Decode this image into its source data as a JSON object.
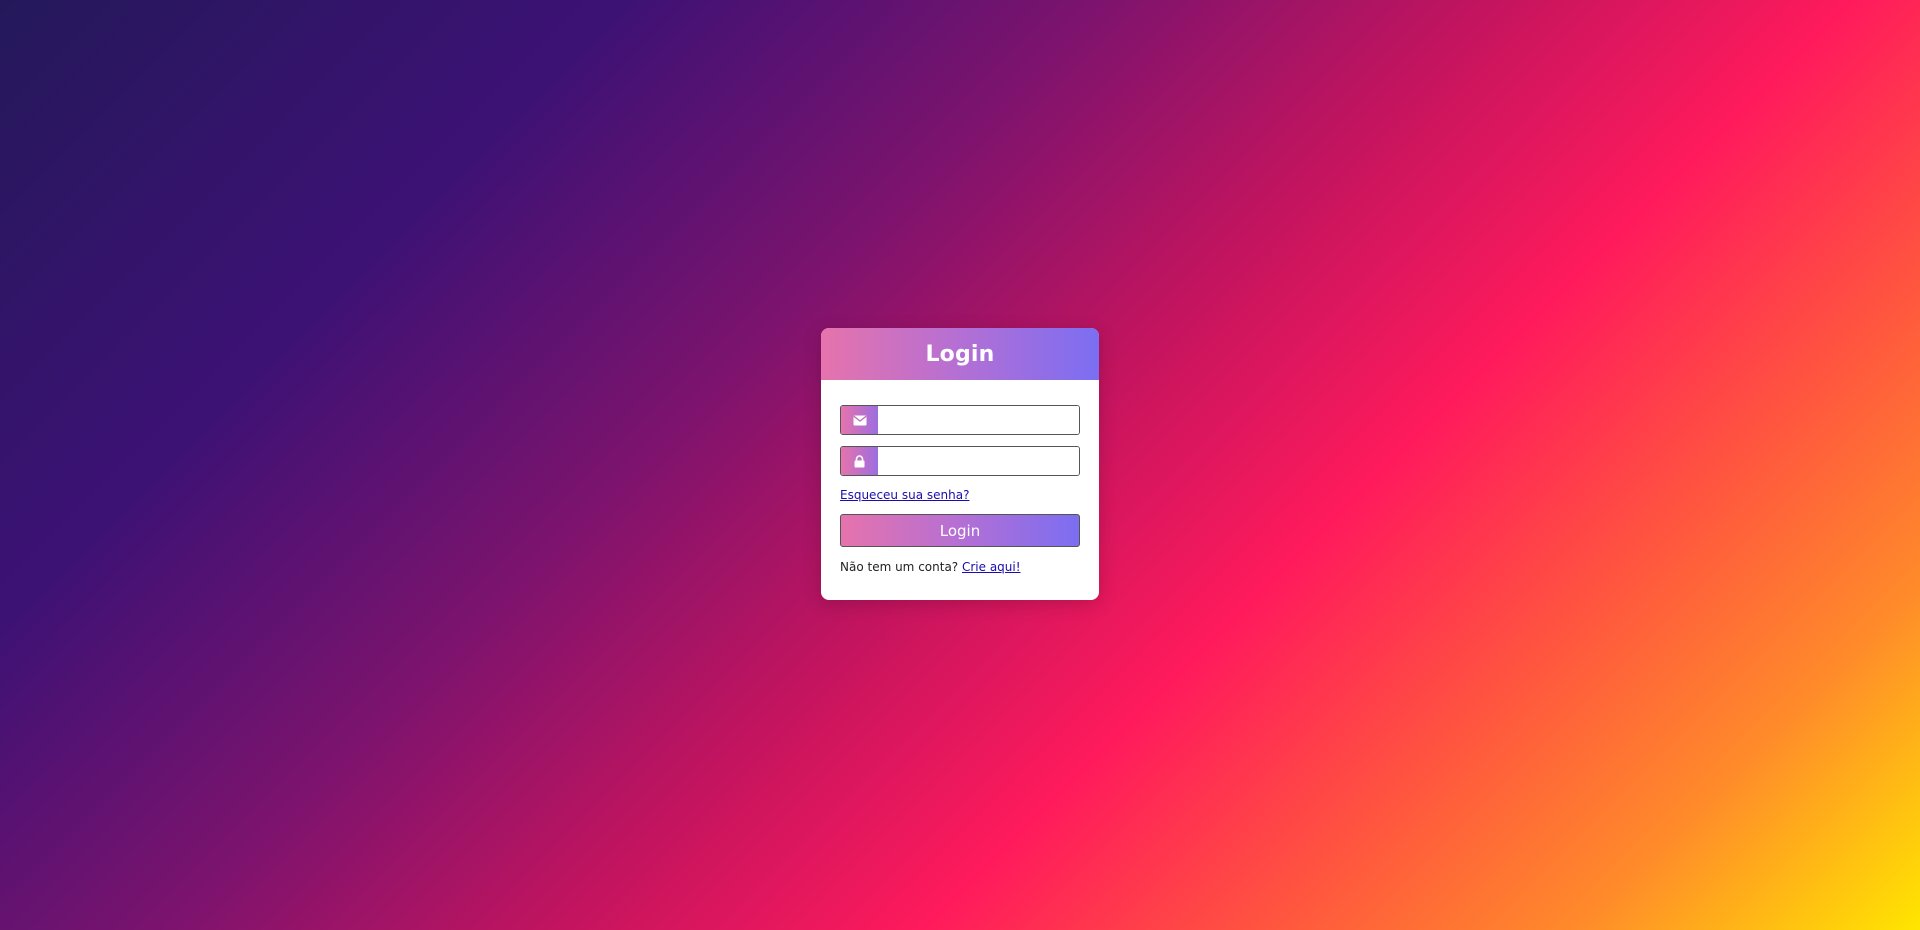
{
  "card": {
    "title": "Login"
  },
  "form": {
    "email": {
      "icon": "envelope-icon",
      "value": "",
      "placeholder": ""
    },
    "password": {
      "icon": "lock-icon",
      "value": "",
      "placeholder": ""
    },
    "forgot_password_label": "Esqueceu sua senha?",
    "submit_label": "Login",
    "signup_prompt": "Não tem um conta?",
    "signup_link_label": "Crie aqui!"
  },
  "colors": {
    "accent_start": "#e673ac",
    "accent_end": "#7b6ef2",
    "link": "#1a0dab"
  }
}
